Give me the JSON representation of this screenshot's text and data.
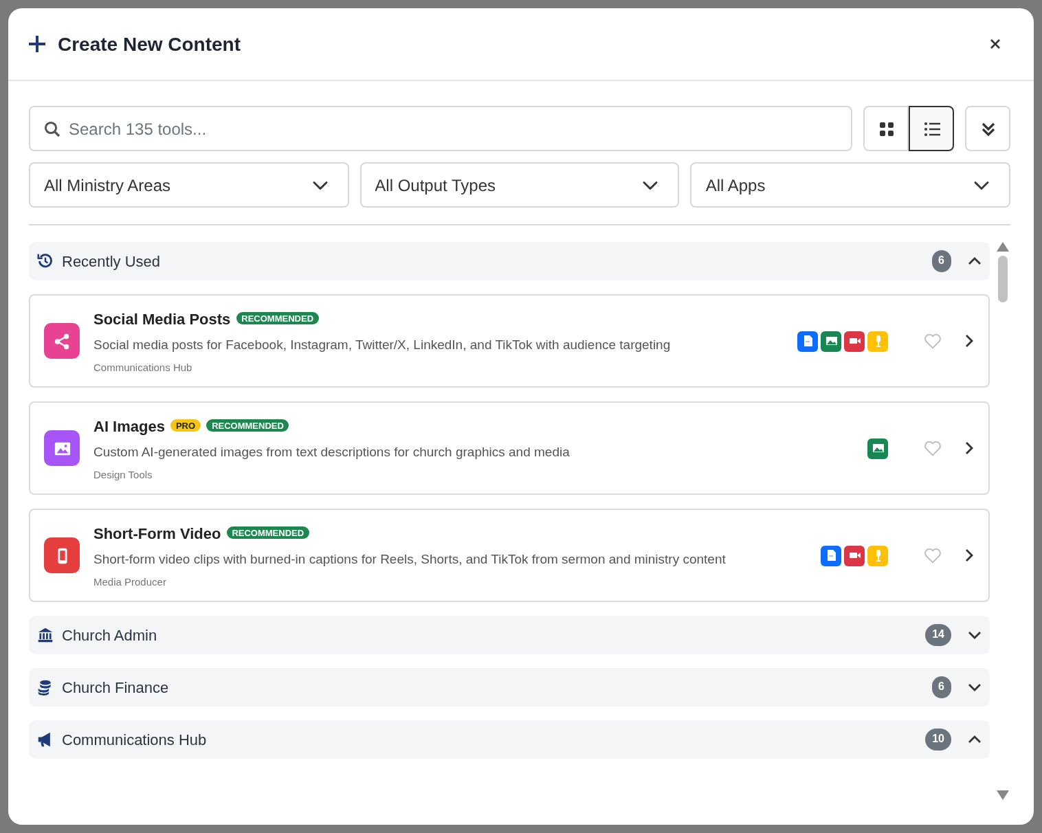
{
  "dialog": {
    "title": "Create New Content"
  },
  "search": {
    "placeholder": "Search 135 tools..."
  },
  "view_toggle": [
    {
      "kind": "grid",
      "selected": false
    },
    {
      "kind": "list",
      "selected": true
    }
  ],
  "filters": [
    {
      "value": "All Ministry Areas"
    },
    {
      "value": "All Output Types"
    },
    {
      "value": "All Apps"
    }
  ],
  "sections": [
    {
      "kind": "history",
      "title": "Recently Used",
      "count": "6",
      "expanded": true,
      "tools": [
        {
          "kind": "share",
          "name": "Social Media Posts",
          "badges": [
            {
              "kind": "recommended",
              "text": "RECOMMENDED"
            }
          ],
          "description": "Social media posts for Facebook, Instagram, Twitter/X, LinkedIn, and TikTok with audience targeting",
          "category": "Communications Hub",
          "outputs": [
            {
              "kind": "document"
            },
            {
              "kind": "image"
            },
            {
              "kind": "video"
            },
            {
              "kind": "audio"
            }
          ],
          "favorite": false
        },
        {
          "kind": "image",
          "name": "AI Images",
          "badges": [
            {
              "kind": "pro",
              "text": "PRO"
            },
            {
              "kind": "recommended",
              "text": "RECOMMENDED"
            }
          ],
          "description": "Custom AI-generated images from text descriptions for church graphics and media",
          "category": "Design Tools",
          "outputs": [
            {
              "kind": "image"
            }
          ],
          "favorite": false
        },
        {
          "kind": "phone",
          "name": "Short-Form Video",
          "badges": [
            {
              "kind": "recommended",
              "text": "RECOMMENDED"
            }
          ],
          "description": "Short-form video clips with burned-in captions for Reels, Shorts, and TikTok from sermon and ministry content",
          "category": "Media Producer",
          "outputs": [
            {
              "kind": "document"
            },
            {
              "kind": "video"
            },
            {
              "kind": "audio"
            }
          ],
          "favorite": false
        }
      ]
    },
    {
      "kind": "bank",
      "title": "Church Admin",
      "count": "14",
      "expanded": false
    },
    {
      "kind": "coins",
      "title": "Church Finance",
      "count": "6",
      "expanded": false
    },
    {
      "kind": "megaphone",
      "title": "Communications Hub",
      "count": "10",
      "expanded": true
    }
  ]
}
